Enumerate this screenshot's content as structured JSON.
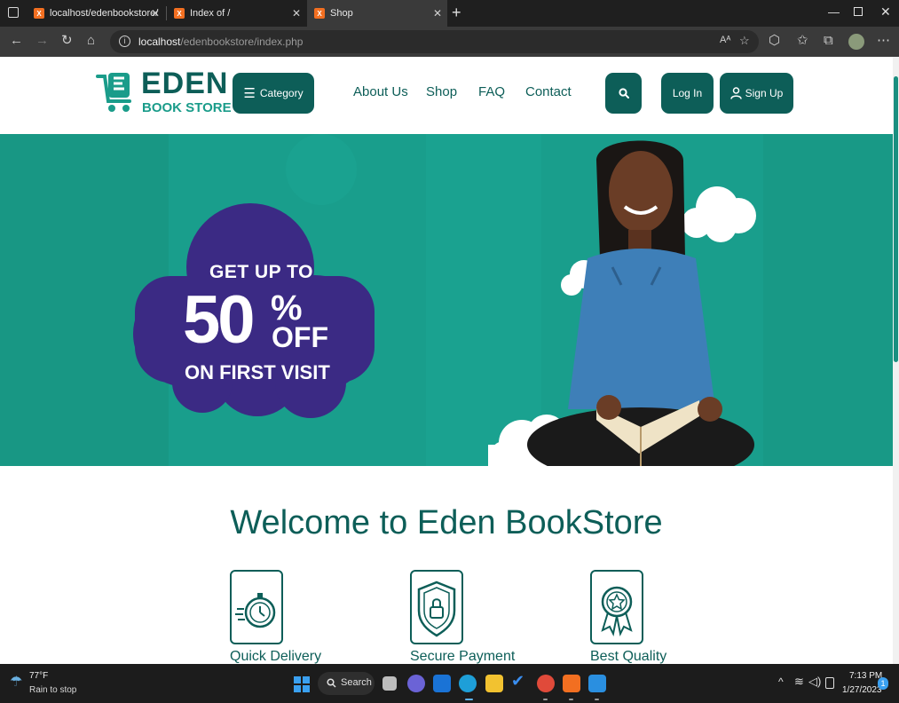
{
  "browser": {
    "tabs": [
      {
        "title": "localhost/edenbookstore/"
      },
      {
        "title": "Index of /"
      },
      {
        "title": "Shop"
      }
    ],
    "url_host": "localhost",
    "url_path": "/edenbookstore/index.php",
    "new_tab_symbol": "+"
  },
  "header": {
    "logo_top": "EDEN",
    "logo_bottom": "BOOK STORE",
    "category_label": "Category",
    "nav": [
      "About Us",
      "Shop",
      "FAQ",
      "Contact"
    ],
    "login_label": "Log In",
    "signup_label": "Sign Up"
  },
  "hero": {
    "promo_line1": "GET UP TO",
    "promo_number": "50",
    "promo_percent": "%",
    "promo_off": "OFF",
    "promo_line3": "ON FIRST VISIT"
  },
  "welcome": {
    "title": "Welcome to Eden BookStore",
    "features": [
      {
        "label": "Quick Delivery",
        "icon": "stopwatch-icon"
      },
      {
        "label": "Secure Payment",
        "icon": "shield-lock-icon"
      },
      {
        "label": "Best Quality",
        "icon": "award-badge-icon"
      }
    ]
  },
  "taskbar": {
    "weather_temp": "77°F",
    "weather_desc": "Rain to stop",
    "search_label": "Search",
    "time": "7:13 PM",
    "date": "1/27/2023",
    "notification_count": "1"
  },
  "colors": {
    "brand_dark": "#0d5e58",
    "hero_teal": "#199e8c",
    "promo_cloud": "#3b2a84"
  }
}
